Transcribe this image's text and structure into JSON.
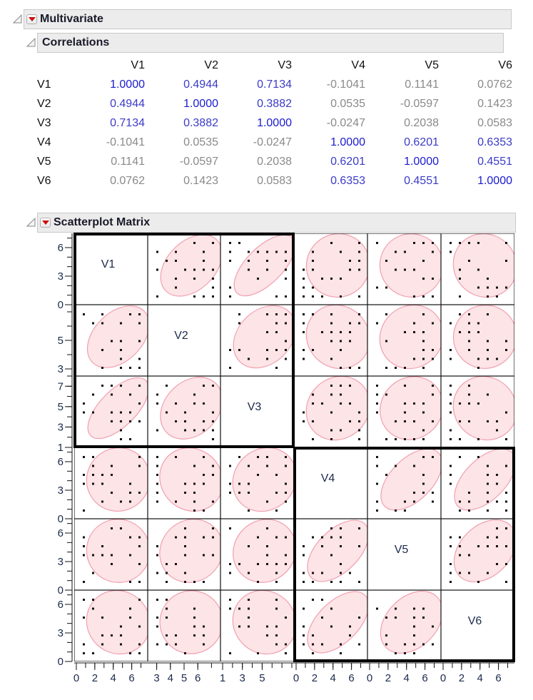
{
  "multivariate": {
    "title": "Multivariate",
    "disclosure_icon": "collapse-triangle-icon",
    "menu_icon": "red-triangle-menu-icon"
  },
  "correlations": {
    "title": "Correlations",
    "disclosure_icon": "collapse-triangle-icon",
    "columns": [
      "V1",
      "V2",
      "V3",
      "V4",
      "V5",
      "V6"
    ],
    "rows": [
      {
        "label": "V1",
        "values": [
          "1.0000",
          "0.4944",
          "0.7134",
          "-0.1041",
          "0.1141",
          "0.0762"
        ]
      },
      {
        "label": "V2",
        "values": [
          "0.4944",
          "1.0000",
          "0.3882",
          "0.0535",
          "-0.0597",
          "0.1423"
        ]
      },
      {
        "label": "V3",
        "values": [
          "0.7134",
          "0.3882",
          "1.0000",
          "-0.0247",
          "0.2038",
          "0.0583"
        ]
      },
      {
        "label": "V4",
        "values": [
          "-0.1041",
          "0.0535",
          "-0.0247",
          "1.0000",
          "0.6201",
          "0.6353"
        ]
      },
      {
        "label": "V5",
        "values": [
          "0.1141",
          "-0.0597",
          "0.2038",
          "0.6201",
          "1.0000",
          "0.4551"
        ]
      },
      {
        "label": "V6",
        "values": [
          "0.0762",
          "0.1423",
          "0.0583",
          "0.6353",
          "0.4551",
          "1.0000"
        ]
      }
    ],
    "colors": {
      "diagonal": "#1a1ad0",
      "strong": "#3b3bc8",
      "weak": "#8a8a8a"
    }
  },
  "scatterplot_matrix": {
    "title": "Scatterplot Matrix",
    "disclosure_icon": "collapse-triangle-icon",
    "menu_icon": "red-triangle-menu-icon"
  },
  "chart_data": {
    "type": "scatter",
    "title": "Scatterplot Matrix",
    "variables": [
      "V1",
      "V2",
      "V3",
      "V4",
      "V5",
      "V6"
    ],
    "correlation": [
      [
        1.0,
        0.4944,
        0.7134,
        -0.1041,
        0.1141,
        0.0762
      ],
      [
        0.4944,
        1.0,
        0.3882,
        0.0535,
        -0.0597,
        0.1423
      ],
      [
        0.7134,
        0.3882,
        1.0,
        -0.0247,
        0.2038,
        0.0583
      ],
      [
        -0.1041,
        0.0535,
        -0.0247,
        1.0,
        0.6201,
        0.6353
      ],
      [
        0.1141,
        -0.0597,
        0.2038,
        0.6201,
        1.0,
        0.4551
      ],
      [
        0.0762,
        0.1423,
        0.0583,
        0.6353,
        0.4551,
        1.0
      ]
    ],
    "axis_ranges": {
      "V1": [
        0,
        7.5
      ],
      "V2": [
        2.5,
        7.5
      ],
      "V3": [
        1,
        8
      ],
      "V4": [
        0,
        7.5
      ],
      "V5": [
        0,
        7.5
      ],
      "V6": [
        0,
        7.5
      ]
    },
    "y_tick_labels": {
      "V1": [
        "0",
        "3",
        "6"
      ],
      "V2": [
        "3",
        "5"
      ],
      "V3": [
        "1",
        "3",
        "5",
        "7"
      ],
      "V4": [
        "0",
        "3",
        "6"
      ],
      "V5": [
        "0",
        "3",
        "6"
      ],
      "V6": [
        "0",
        "3",
        "6"
      ]
    },
    "x_tick_labels": {
      "V1": [
        "0",
        "2",
        "4",
        "6"
      ],
      "V2": [
        "3",
        "4",
        "5",
        "6"
      ],
      "V3": [
        "1",
        "3",
        "5"
      ],
      "V4": [
        "0",
        "2",
        "4",
        "6"
      ],
      "V5": [
        "0",
        "2",
        "4",
        "6"
      ],
      "V6": [
        "0",
        "2",
        "4",
        "6"
      ]
    },
    "groups_outlined": [
      [
        "V1",
        "V2",
        "V3"
      ],
      [
        "V4",
        "V5",
        "V6"
      ]
    ],
    "density_ellipse": {
      "coverage": "95%",
      "fill": "#fde4e6",
      "stroke": "#f0a0b0"
    },
    "point_color": "#111111",
    "points": {
      "V1": [
        6,
        5,
        4,
        4,
        3,
        2,
        1,
        6,
        5,
        4,
        3,
        2,
        6,
        5,
        4,
        6,
        5,
        4,
        3,
        3,
        2,
        7,
        6,
        5,
        4,
        6,
        5
      ],
      "V2": [
        6,
        6,
        5,
        5,
        4,
        4,
        5,
        5,
        6,
        7,
        7,
        3,
        3,
        3,
        5,
        5,
        5,
        6,
        6,
        5,
        7,
        6,
        5,
        4,
        4,
        6,
        6
      ],
      "V3": [
        7,
        7,
        7,
        5,
        5,
        4,
        4,
        3,
        4,
        5,
        6,
        6,
        6,
        5,
        4,
        4,
        2,
        5,
        7,
        7,
        5,
        6,
        5,
        5,
        4,
        5,
        7
      ]
    }
  }
}
